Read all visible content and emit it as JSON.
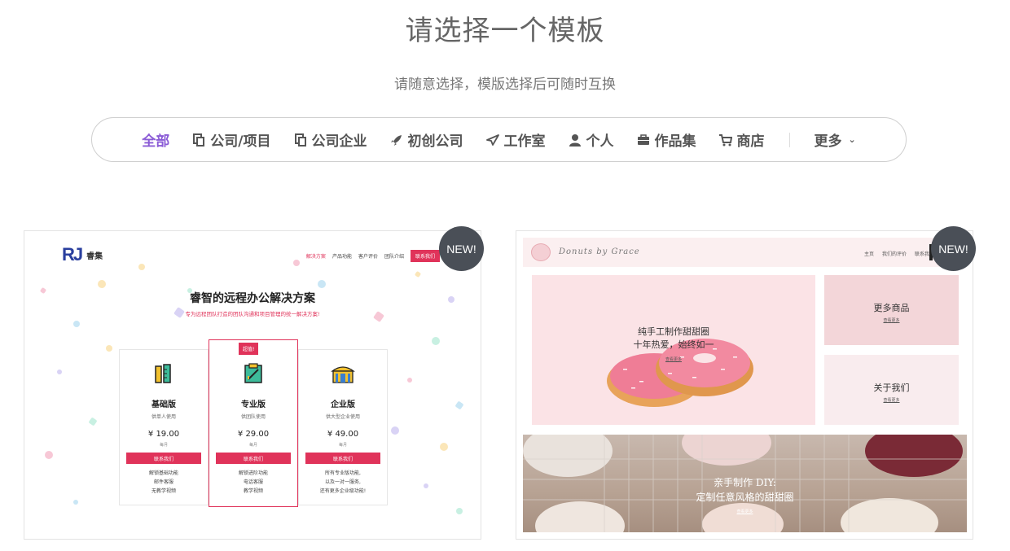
{
  "header": {
    "title": "请选择一个模板",
    "subtitle": "请随意选择，模版选择后可随时互换"
  },
  "nav": {
    "items": [
      {
        "label": "全部",
        "icon": "none",
        "active": true
      },
      {
        "label": "公司/项目",
        "icon": "copy-icon"
      },
      {
        "label": "公司企业",
        "icon": "copy-icon"
      },
      {
        "label": "初创公司",
        "icon": "rocket-icon"
      },
      {
        "label": "工作室",
        "icon": "send-icon"
      },
      {
        "label": "个人",
        "icon": "user-icon"
      },
      {
        "label": "作品集",
        "icon": "briefcase-icon"
      },
      {
        "label": "商店",
        "icon": "cart-icon"
      }
    ],
    "more_label": "更多",
    "accent": "#8a5bd6"
  },
  "templates": [
    {
      "badge": "NEW!",
      "logo": "RJ",
      "brand": "睿集",
      "nav": [
        "解决方案",
        "产品功能",
        "客户评价",
        "团队介绍"
      ],
      "nav_button": "联系我们",
      "title": "睿智的远程办公解决方案",
      "subtitle": "专为远程团队打造的团队沟通和项目管理的统一解决方案!",
      "accent": "#e0335a",
      "plans": [
        {
          "name": "基础版",
          "desc": "供单人使用",
          "price": "¥ 19.00",
          "unit": "每月",
          "button": "联系我们",
          "features": "解锁基础功能\n邮件客服\n无教学视频"
        },
        {
          "name": "专业版",
          "flag": "超值!",
          "desc": "供团队使用",
          "price": "¥ 29.00",
          "unit": "每月",
          "button": "联系我们",
          "features": "解锁进阶功能\n电话客服\n教学视频"
        },
        {
          "name": "企业版",
          "desc": "供大型企业使用",
          "price": "¥ 49.00",
          "unit": "每月",
          "button": "联系我们",
          "features": "所有专业版功能,\n以及一对一服务,\n还有更多企业级功能!"
        }
      ]
    },
    {
      "badge": "NEW!",
      "brand": "Donuts by Grace",
      "nav": [
        "主页",
        "我们的评价",
        "联系我们"
      ],
      "hero_line1": "纯手工制作甜甜圈",
      "hero_line2": "十年热爱，始终如一",
      "hero_link": "查看更多",
      "side1_title": "更多商品",
      "side1_link": "查看更多",
      "side2_title": "关于我们",
      "side2_link": "查看更多",
      "banner_line1": "亲手制作 DIY:",
      "banner_line2": "定制任意风格的甜甜圈",
      "banner_link": "查看更多"
    }
  ]
}
